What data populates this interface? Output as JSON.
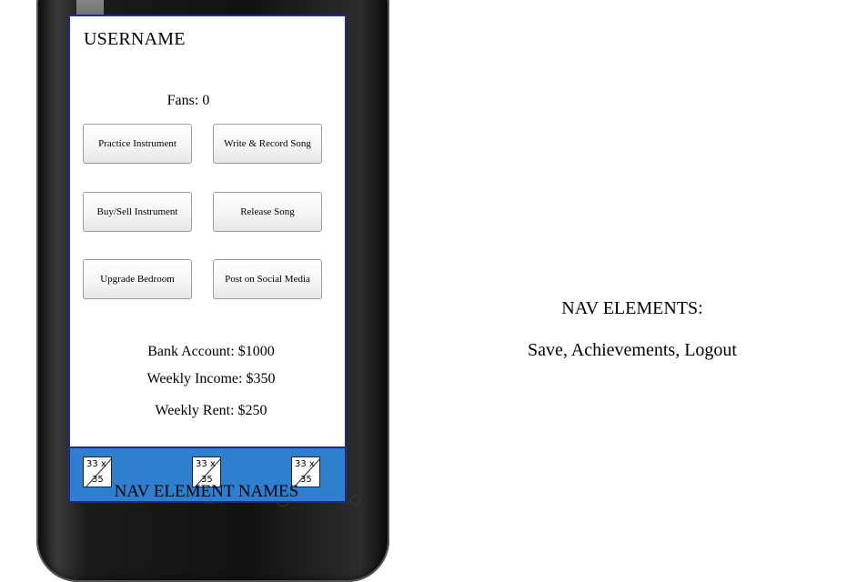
{
  "screen": {
    "username": "USERNAME",
    "fans_label": "Fans:",
    "fans_value": "0",
    "actions": [
      {
        "label": "Practice Instrument"
      },
      {
        "label": "Write & Record Song"
      },
      {
        "label": "Buy/Sell Instrument"
      },
      {
        "label": "Release Song"
      },
      {
        "label": "Upgrade Bedroom"
      },
      {
        "label": "Post on Social Media"
      }
    ],
    "stats": {
      "bank": "Bank Account: $1000",
      "income": "Weekly Income: $350",
      "rent": "Weekly Rent: $250"
    }
  },
  "navbar": {
    "icons": [
      {
        "top": "33 x",
        "bottom": "35",
        "icon": "placeholder-image-icon"
      },
      {
        "top": "33 x",
        "bottom": "35",
        "icon": "placeholder-image-icon"
      },
      {
        "top": "33 x",
        "bottom": "35",
        "icon": "placeholder-image-icon"
      }
    ],
    "names_label": "NAV ELEMENT NAMES",
    "background_color": "#2f7fd0"
  },
  "notes": {
    "title": "NAV ELEMENTS:",
    "list": "Save, Achievements, Logout"
  }
}
